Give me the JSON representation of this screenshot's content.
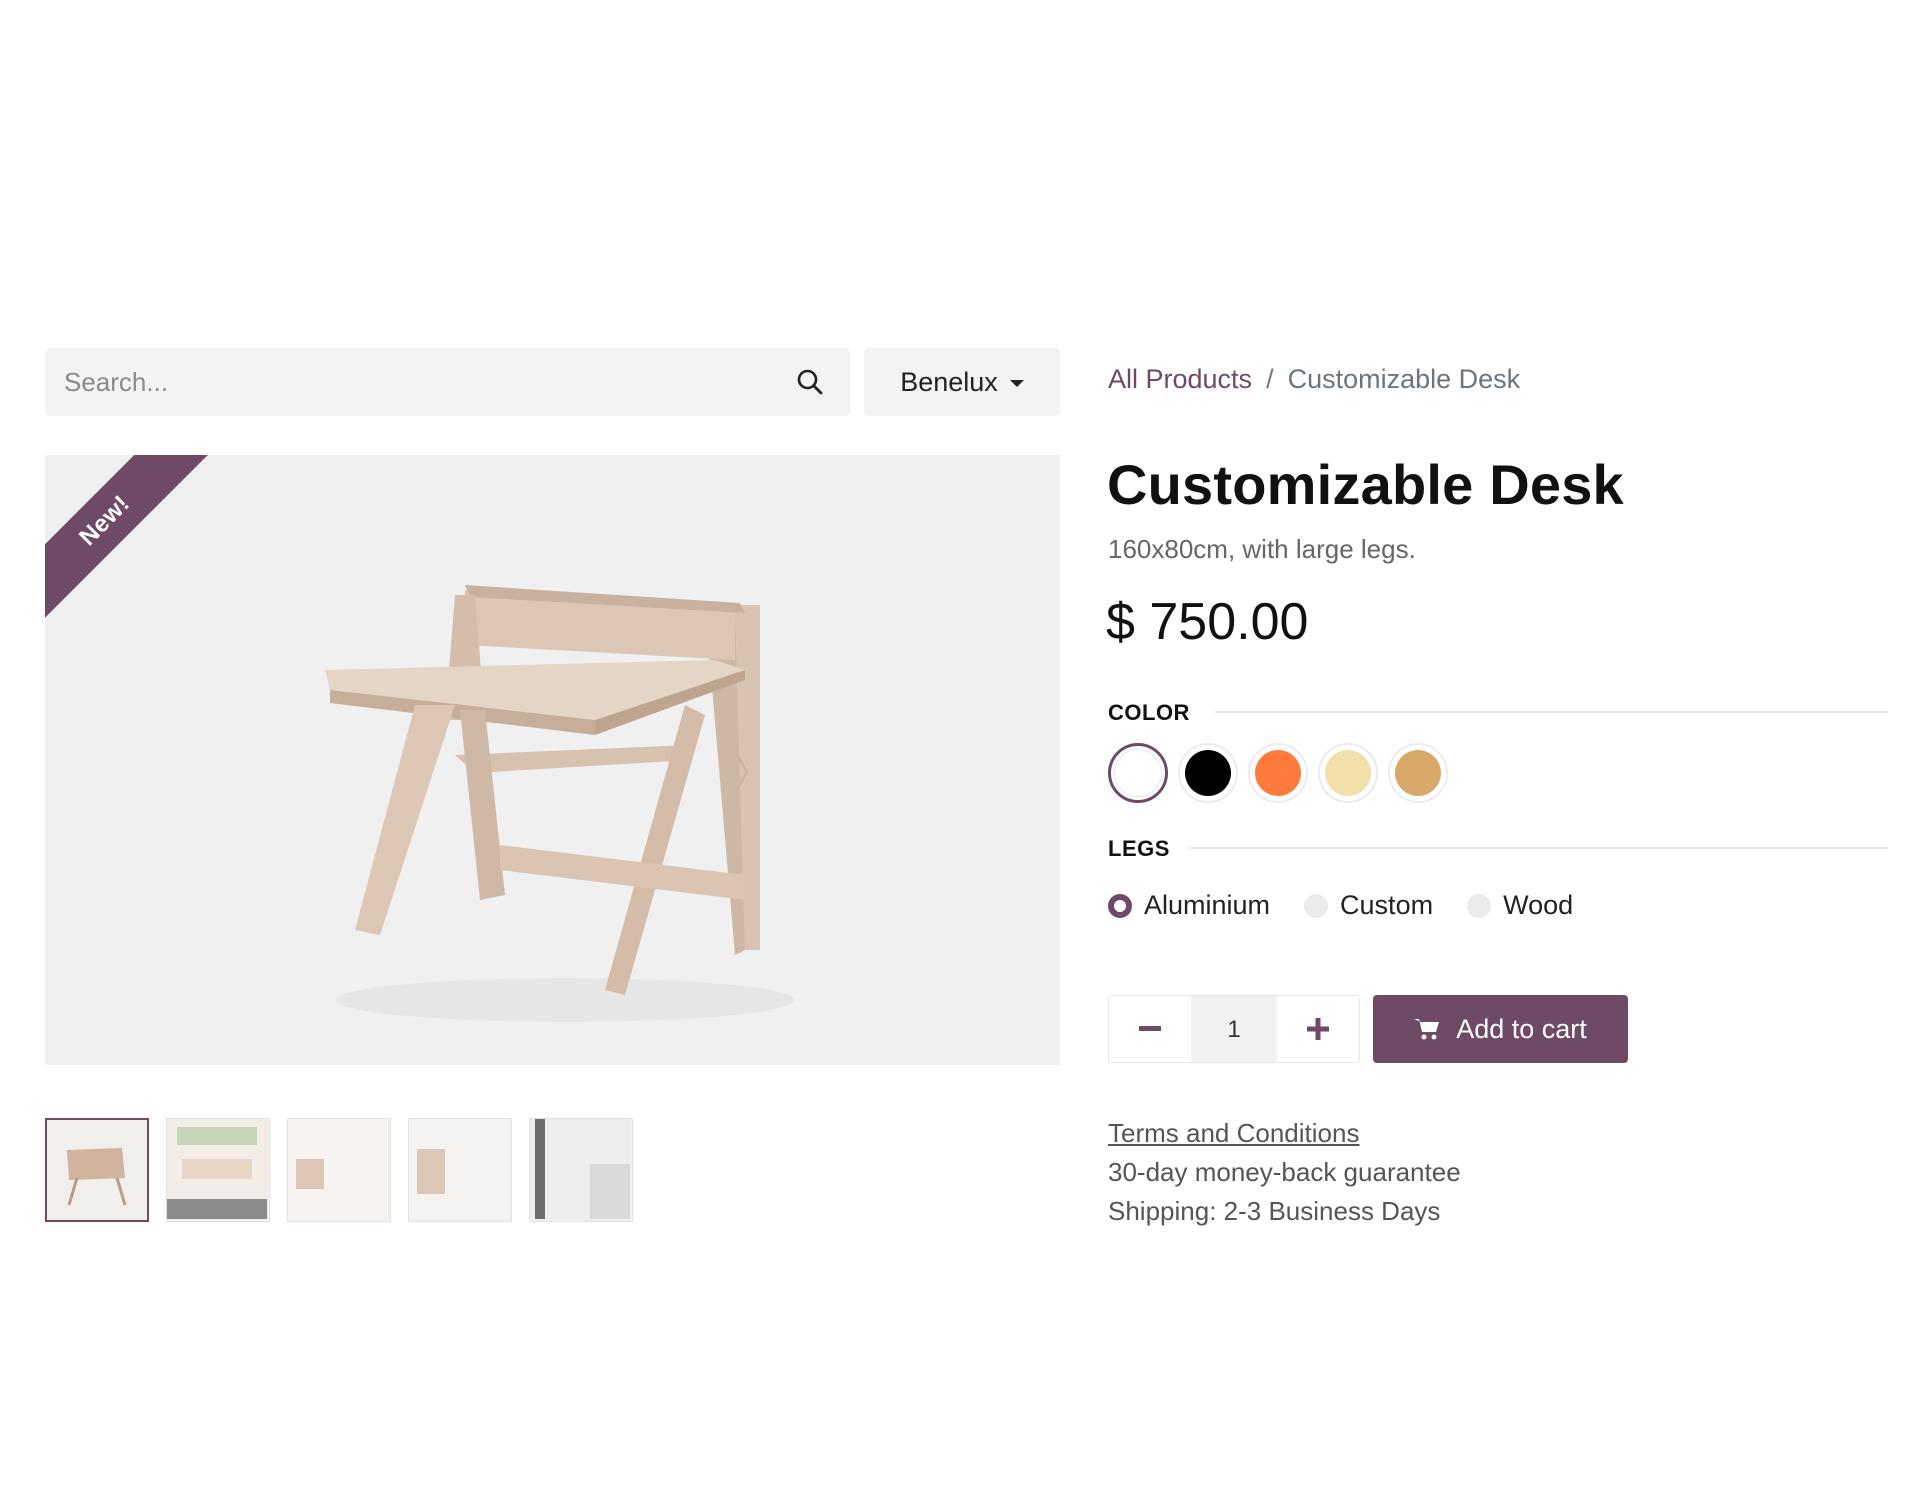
{
  "search": {
    "placeholder": "Search..."
  },
  "pricelist": {
    "label": "Benelux"
  },
  "ribbon": "New!",
  "breadcrumb": {
    "parent": "All Products",
    "separator": "/",
    "current": "Customizable Desk"
  },
  "product": {
    "title": "Customizable Desk",
    "subtitle": "160x80cm, with large legs.",
    "price": "$ 750.00"
  },
  "attributes": {
    "color": {
      "label": "COLOR",
      "options": [
        "#ffffff",
        "#000000",
        "#ff7a3d",
        "#f3dfaa",
        "#d9a96a"
      ],
      "selected": "#ffffff"
    },
    "legs": {
      "label": "LEGS",
      "options": [
        "Aluminium",
        "Custom",
        "Wood"
      ],
      "selected": "Aluminium"
    }
  },
  "quantity": {
    "value": "1"
  },
  "cart": {
    "label": "Add to cart"
  },
  "info": {
    "terms": "Terms and Conditions",
    "guarantee": "30-day money-back guarantee",
    "shipping": "Shipping: 2-3 Business Days"
  },
  "colors": {
    "accent": "#6e4a66",
    "image_bg": "#f0f0f0"
  }
}
